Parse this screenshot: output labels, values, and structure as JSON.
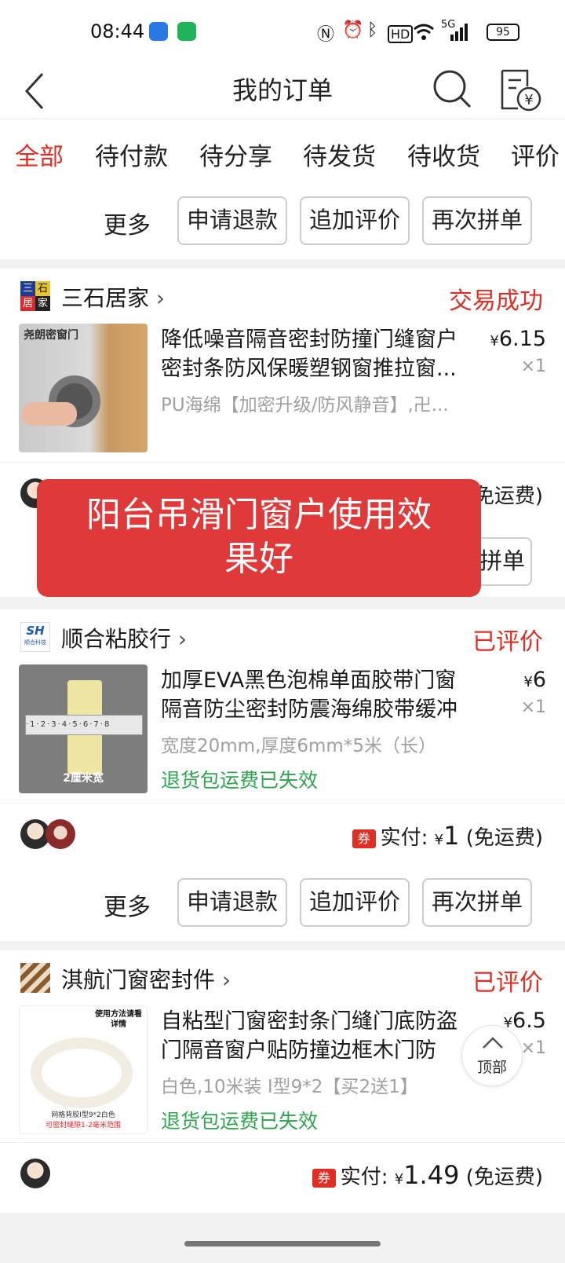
{
  "status_bar": {
    "time": "08:44",
    "hd": "HD",
    "signal": "5G",
    "battery": "95"
  },
  "header": {
    "title": "我的订单"
  },
  "tabs": [
    {
      "label": "全部"
    },
    {
      "label": "待付款"
    },
    {
      "label": "待分享"
    },
    {
      "label": "待发货"
    },
    {
      "label": "待收货"
    },
    {
      "label": "评价"
    }
  ],
  "actions": {
    "more": "更多",
    "refund": "申请退款",
    "add_review": "追加评价",
    "reorder": "再次拼单"
  },
  "orders": [
    {
      "shop": "三石居家",
      "logo_text": [
        "三",
        "石",
        "居",
        "家"
      ],
      "status": "交易成功",
      "title": "降低噪音隔音密封防撞门缝窗户密封条防风保暖塑钢窗推拉窗...",
      "price": "6.15",
      "qty": "×1",
      "spec": "PU海绵【加密升级/防风静音】,卍...",
      "thumb_text": "尧朗密窗门",
      "paid_suffix": "免运费)",
      "reorder_partial": "拼单"
    },
    {
      "shop": "顺合粘胶行",
      "logo_text": "SH",
      "logo_sub": "顺合科技",
      "status": "已评价",
      "title": "加厚EVA黑色泡棉单面胶带门窗隔音防尘密封防震海绵胶带缓冲防撞",
      "price": "6",
      "qty": "×1",
      "spec": "宽度20mm,厚度6mm*5米（长）",
      "expire": "退货包运费已失效",
      "thumb_text": "2厘米宽",
      "coupon": "券",
      "paid_label": "实付:",
      "paid_amount": "1",
      "free_ship": "(免运费)"
    },
    {
      "shop": "淇航门窗密封件",
      "status": "已评价",
      "title": "自粘型门窗密封条门缝门底防盗门隔音窗户贴防撞边框木门防风...",
      "price": "6.5",
      "qty": "×1",
      "spec": "白色,10米装 I型9*2【买2送1】",
      "expire": "退货包运费已失效",
      "thumb_text": "使用方法请看详情",
      "thumb_text2": "网格背胶I型9*2白色",
      "thumb_text3": "可密封缝隙1-2毫米范围",
      "coupon": "券",
      "paid_label": "实付:",
      "paid_amount": "1.49",
      "free_ship": "(免运费)"
    }
  ],
  "currency": "¥",
  "toast": {
    "line1": "阳台吊滑门窗户使用效",
    "line2": "果好"
  },
  "back_to_top": "顶部",
  "colors": {
    "accent": "#e02e24",
    "success": "#2ea44f",
    "toast": "#e0393a"
  }
}
